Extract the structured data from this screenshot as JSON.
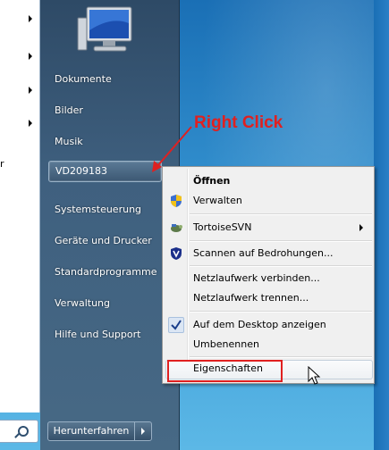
{
  "start_menu": {
    "left_truncated_text": "r",
    "right_items": [
      {
        "label": "Dokumente"
      },
      {
        "label": "Bilder"
      },
      {
        "label": "Musik"
      },
      {
        "label": "VD209183"
      },
      {
        "label": "Systemsteuerung"
      },
      {
        "label": "Geräte und Drucker"
      },
      {
        "label": "Standardprogramme"
      },
      {
        "label": "Verwaltung"
      },
      {
        "label": "Hilfe und Support"
      }
    ],
    "shutdown_label": "Herunterfahren"
  },
  "annotation": {
    "text": "Right Click",
    "color": "#e02020"
  },
  "context_menu": {
    "items": [
      {
        "label": "Öffnen",
        "bold": true
      },
      {
        "label": "Verwalten",
        "icon": "uac-shield-icon"
      },
      {
        "label": "TortoiseSVN",
        "icon": "tortoisesvn-icon",
        "submenu": true
      },
      {
        "label": "Scannen auf Bedrohungen...",
        "icon": "security-shield-icon"
      },
      {
        "label": "Netzlaufwerk verbinden..."
      },
      {
        "label": "Netzlaufwerk trennen..."
      },
      {
        "label": "Auf dem Desktop anzeigen",
        "icon": "checkmark-icon",
        "checked": true
      },
      {
        "label": "Umbenennen"
      },
      {
        "label": "Eigenschaften"
      }
    ]
  }
}
